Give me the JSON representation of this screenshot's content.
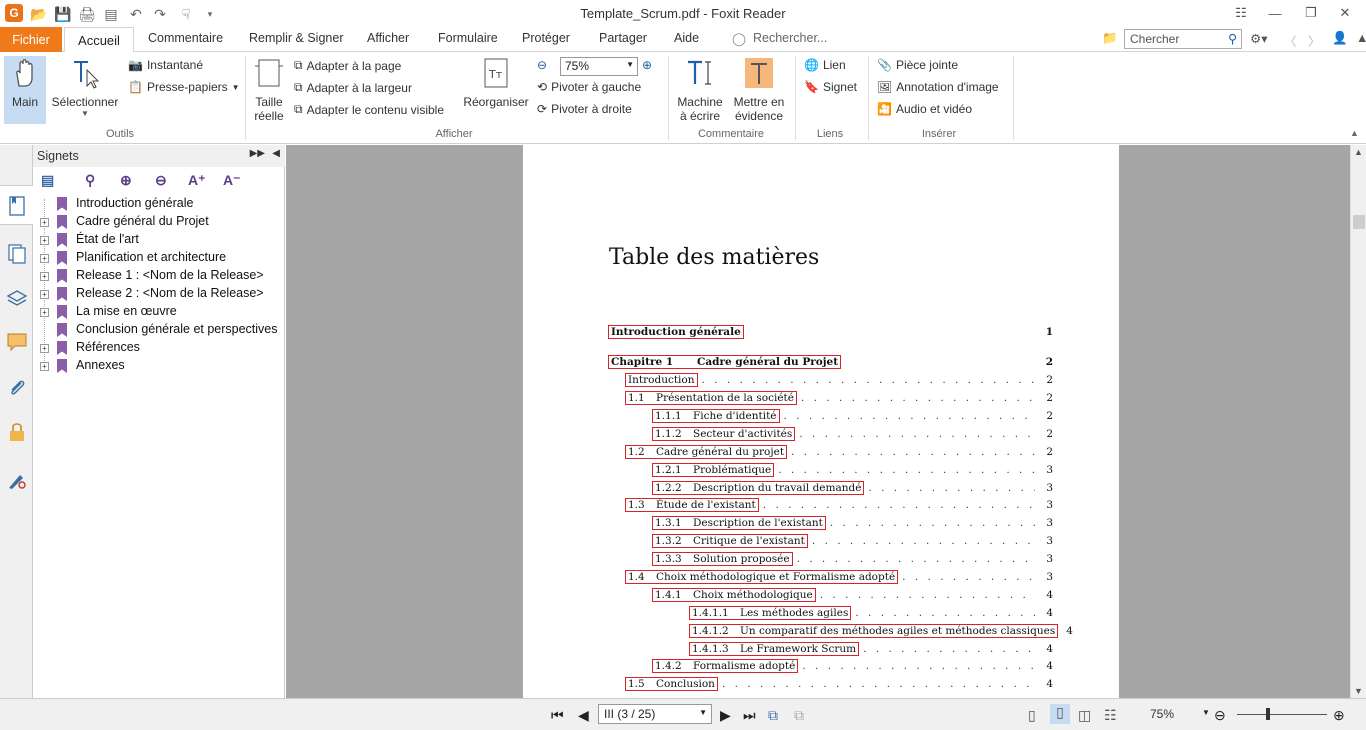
{
  "window": {
    "title": "Template_Scrum.pdf - Foxit Reader"
  },
  "tabs": {
    "file": "Fichier",
    "active": "Accueil",
    "items": [
      "Commentaire",
      "Remplir & Signer",
      "Afficher",
      "Formulaire",
      "Protéger",
      "Partager",
      "Aide"
    ],
    "tell_me": "Rechercher...",
    "search_placeholder": "Chercher"
  },
  "ribbon": {
    "tools": {
      "hand": "Main",
      "select": "Sélectionner",
      "snapshot": "Instantané",
      "clipboard": "Presse-papiers",
      "group": "Outils"
    },
    "view": {
      "actual_size_1": "Taille",
      "actual_size_2": "réelle",
      "fit_page": "Adapter à la page",
      "fit_width": "Adapter à la largeur",
      "fit_visible": "Adapter le contenu visible",
      "reflow": "Réorganiser",
      "zoom": "75%",
      "rotate_left": "Pivoter à gauche",
      "rotate_right": "Pivoter à droite",
      "group": "Afficher"
    },
    "comment": {
      "typewriter_1": "Machine",
      "typewriter_2": "à écrire",
      "highlight_1": "Mettre en",
      "highlight_2": "évidence",
      "group": "Commentaire"
    },
    "links": {
      "link": "Lien",
      "bookmark": "Signet",
      "group": "Liens"
    },
    "insert": {
      "attachment": "Pièce jointe",
      "image": "Annotation d'image",
      "audio": "Audio et vidéo",
      "group": "Insérer"
    }
  },
  "bookmarks": {
    "title": "Signets",
    "items": [
      "Introduction générale",
      "Cadre général du Projet",
      "État de l'art",
      "Planification et architecture",
      "Release 1 : <Nom de la Release>",
      "Release 2 : <Nom de la Release>",
      "La mise en œuvre",
      "Conclusion générale et perspectives",
      "Références",
      "Annexes"
    ]
  },
  "document": {
    "heading": "Table des matières",
    "toc": [
      {
        "num": "",
        "text": "Introduction générale",
        "page": "1",
        "bold": true
      },
      {
        "num": "Chapitre 1",
        "text": "Cadre général du Projet",
        "page": "2",
        "bold": true
      },
      {
        "num": "",
        "text": "Introduction",
        "page": "2"
      },
      {
        "num": "1.1",
        "text": "Présentation de la société",
        "page": "2"
      },
      {
        "num": "1.1.1",
        "text": "Fiche d'identité",
        "page": "2"
      },
      {
        "num": "1.1.2",
        "text": "Secteur d'activités",
        "page": "2"
      },
      {
        "num": "1.2",
        "text": "Cadre général du projet",
        "page": "2"
      },
      {
        "num": "1.2.1",
        "text": "Problématique",
        "page": "3"
      },
      {
        "num": "1.2.2",
        "text": "Description du travail demandé",
        "page": "3"
      },
      {
        "num": "1.3",
        "text": "Étude de l'existant",
        "page": "3"
      },
      {
        "num": "1.3.1",
        "text": "Description de l'existant",
        "page": "3"
      },
      {
        "num": "1.3.2",
        "text": "Critique de l'existant",
        "page": "3"
      },
      {
        "num": "1.3.3",
        "text": "Solution proposée",
        "page": "3"
      },
      {
        "num": "1.4",
        "text": "Choix méthodologique et Formalisme adopté",
        "page": "3"
      },
      {
        "num": "1.4.1",
        "text": "Choix méthodologique",
        "page": "4"
      },
      {
        "num": "1.4.1.1",
        "text": "Les méthodes agiles",
        "page": "4"
      },
      {
        "num": "1.4.1.2",
        "text": "Un comparatif des méthodes agiles et méthodes classiques",
        "page": "4"
      },
      {
        "num": "1.4.1.3",
        "text": "Le Framework Scrum",
        "page": "4"
      },
      {
        "num": "1.4.2",
        "text": "Formalisme adopté",
        "page": "4"
      },
      {
        "num": "1.5",
        "text": "Conclusion",
        "page": "4"
      }
    ]
  },
  "status": {
    "page": "III (3 / 25)",
    "zoom": "75%"
  },
  "colors": {
    "accent": "#f07a1a",
    "bookmark": "#8b5ea8",
    "link_box": "#d8232a"
  }
}
